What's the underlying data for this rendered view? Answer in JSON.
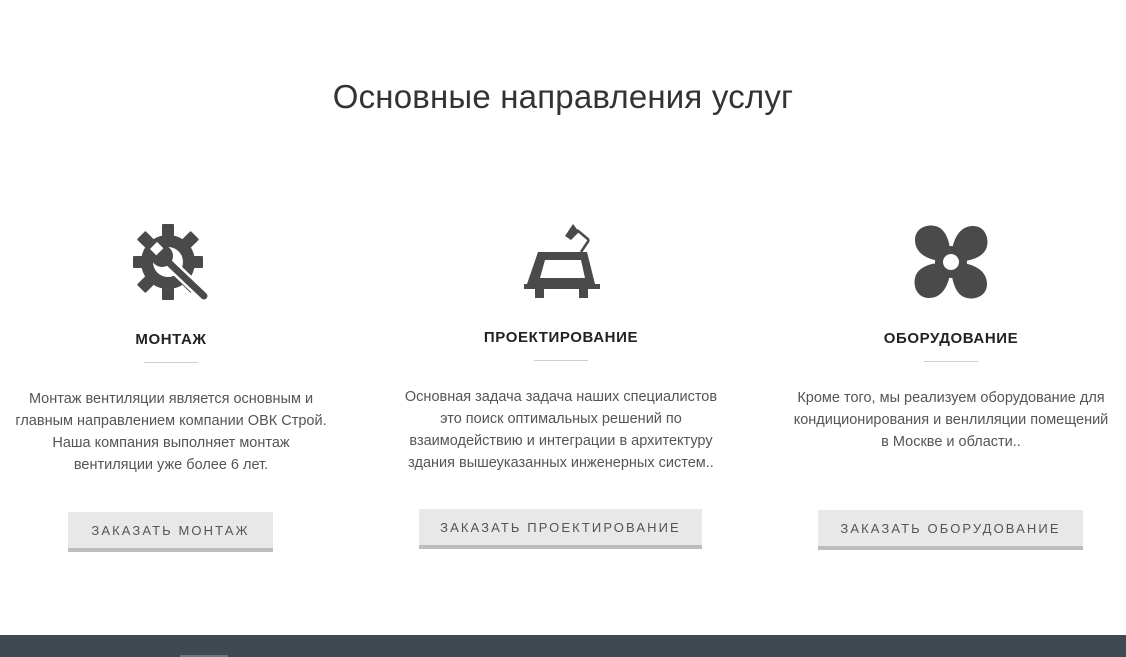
{
  "section": {
    "title": "Основные направления услуг"
  },
  "services": [
    {
      "icon": "gear-wrench-icon",
      "title": "МОНТАЖ",
      "description": [
        "Монтаж вентиляции является основным и",
        "главным направлением компании ОВК Строй.",
        "Наша компания выполняет монтаж",
        "вентиляции уже более 6 лет."
      ],
      "button": "ЗАКАЗАТЬ МОНТАЖ"
    },
    {
      "icon": "drafting-table-icon",
      "title": "ПРОЕКТИРОВАНИЕ",
      "description": [
        "Основная задача задача наших специалистов",
        "это поиск оптимальных решений по",
        "взаимодействию и интеграции в архитектуру",
        "здания вышеуказанных инженерных систем.."
      ],
      "button": "ЗАКАЗАТЬ ПРОЕКТИРОВАНИЕ"
    },
    {
      "icon": "fan-icon",
      "title": "ОБОРУДОВАНИЕ",
      "description": [
        "Кроме того, мы реализуем оборудование для",
        "кондиционирования и венлиляции помещений",
        "в Москве и области.."
      ],
      "button": "ЗАКАЗАТЬ ОБОРУДОВАНИЕ"
    }
  ],
  "colors": {
    "icon": "#4a4a4a",
    "button_bg": "#e8e8e8",
    "button_border": "#bdbdbd",
    "footer": "#3f4952"
  }
}
